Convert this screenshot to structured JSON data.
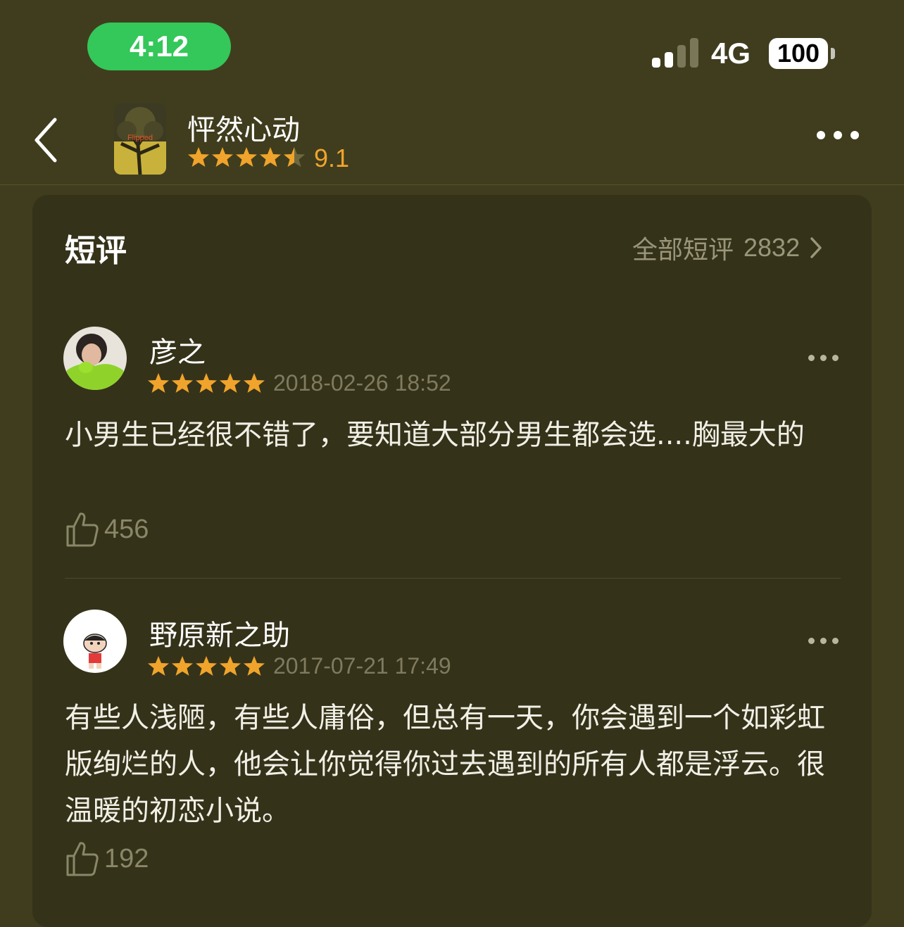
{
  "status_bar": {
    "time": "4:12",
    "network": "4G",
    "battery": "100"
  },
  "header": {
    "book_title": "怦然心动",
    "rating": "9.1",
    "rating_stars": 4.5,
    "cover_text": "Flipped"
  },
  "section": {
    "title": "短评",
    "all_label": "全部短评",
    "all_count": "2832"
  },
  "reviews": [
    {
      "user": "彦之",
      "stars": 5,
      "date": "2018-02-26 18:52",
      "text": "小男生已经很不错了，要知道大部分男生都会选....胸最大的",
      "likes": "456"
    },
    {
      "user": "野原新之助",
      "stars": 5,
      "date": "2017-07-21 17:49",
      "text": "有些人浅陋，有些人庸俗，但总有一天，你会遇到一个如彩虹版绚烂的人，他会让你觉得你过去遇到的所有人都是浮云。很温暖的初恋小说。",
      "likes": "192"
    }
  ],
  "colors": {
    "background": "#403d1e",
    "card": "#35321a",
    "accent_star": "#f0a42b",
    "time_pill": "#34c759"
  },
  "icons": [
    "back-chevron-icon",
    "more-icon",
    "star-icon",
    "chevron-right-icon",
    "thumbs-up-icon"
  ]
}
